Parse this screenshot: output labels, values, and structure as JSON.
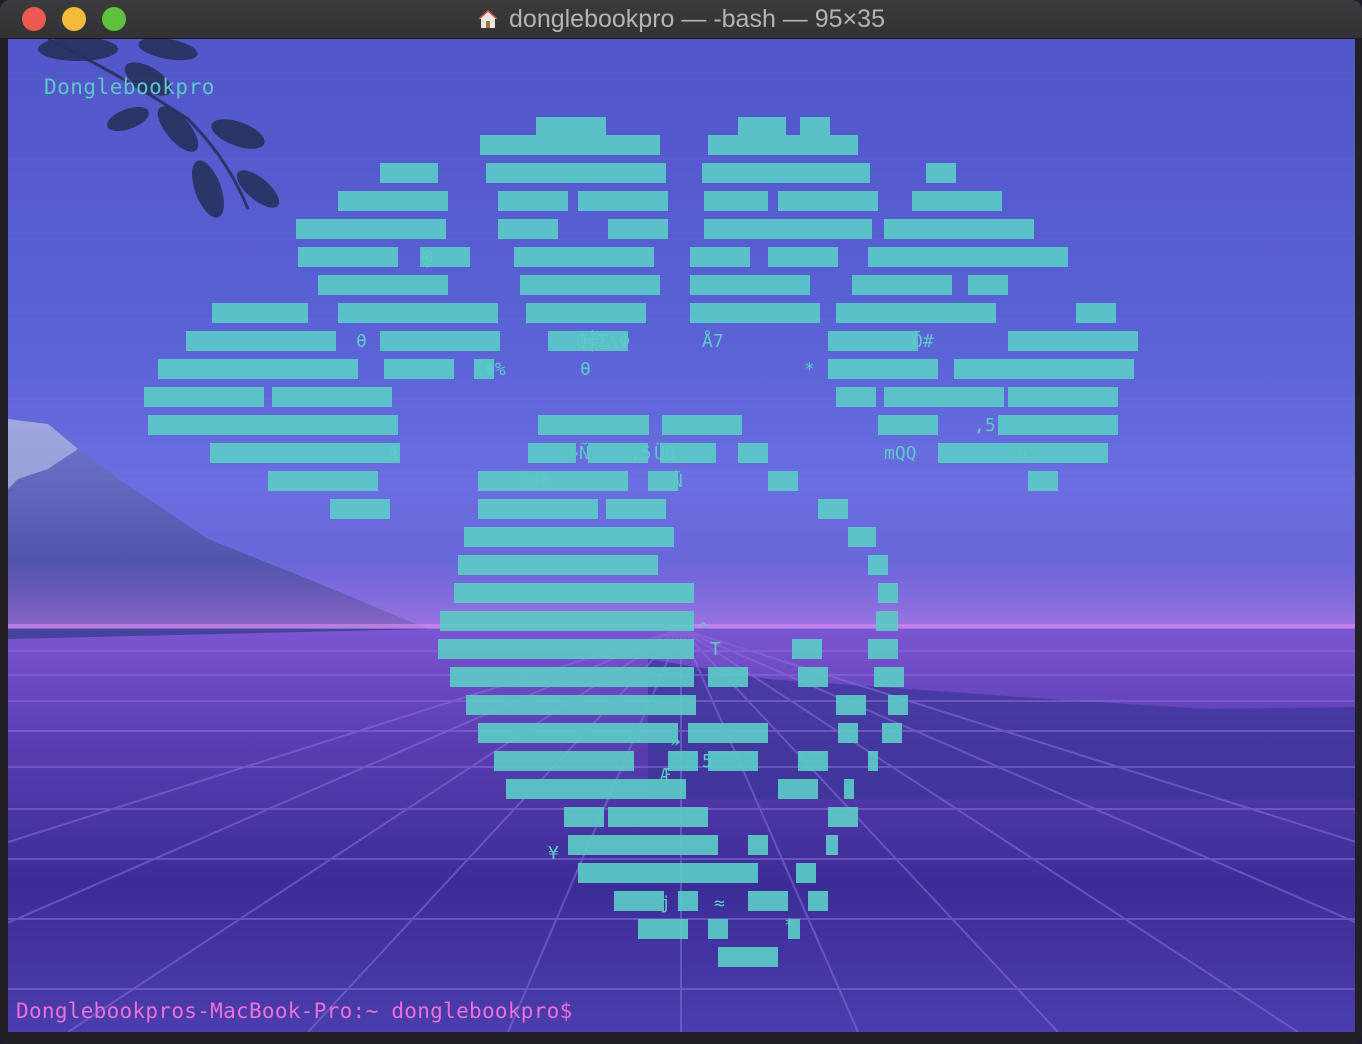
{
  "window": {
    "title": "donglebookpro — -bash — 95×35"
  },
  "terminal": {
    "hostname_text": "Donglebookpro",
    "prompt": "Donglebookpros-MacBook-Pro:~ donglebookpro$",
    "art_glyphs": [
      "@",
      "Φ%",
      "θ",
      "Q╪Σ\\Φ",
      "Å7",
      "Ö#",
      "*",
      "»Ñ",
      ",5",
      "ÜQ",
      "Ö»δ",
      "Ñ",
      "mQQ",
      ",5",
      "«",
      "Æ",
      "θ",
      "^",
      "T",
      "»",
      "Æ",
      "5",
      "¥",
      "j",
      "≈",
      "*",
      "┐"
    ]
  },
  "colors": {
    "art": "#5ccac8",
    "prompt": "#ef6fd8",
    "hostname": "#5bc8c8"
  }
}
